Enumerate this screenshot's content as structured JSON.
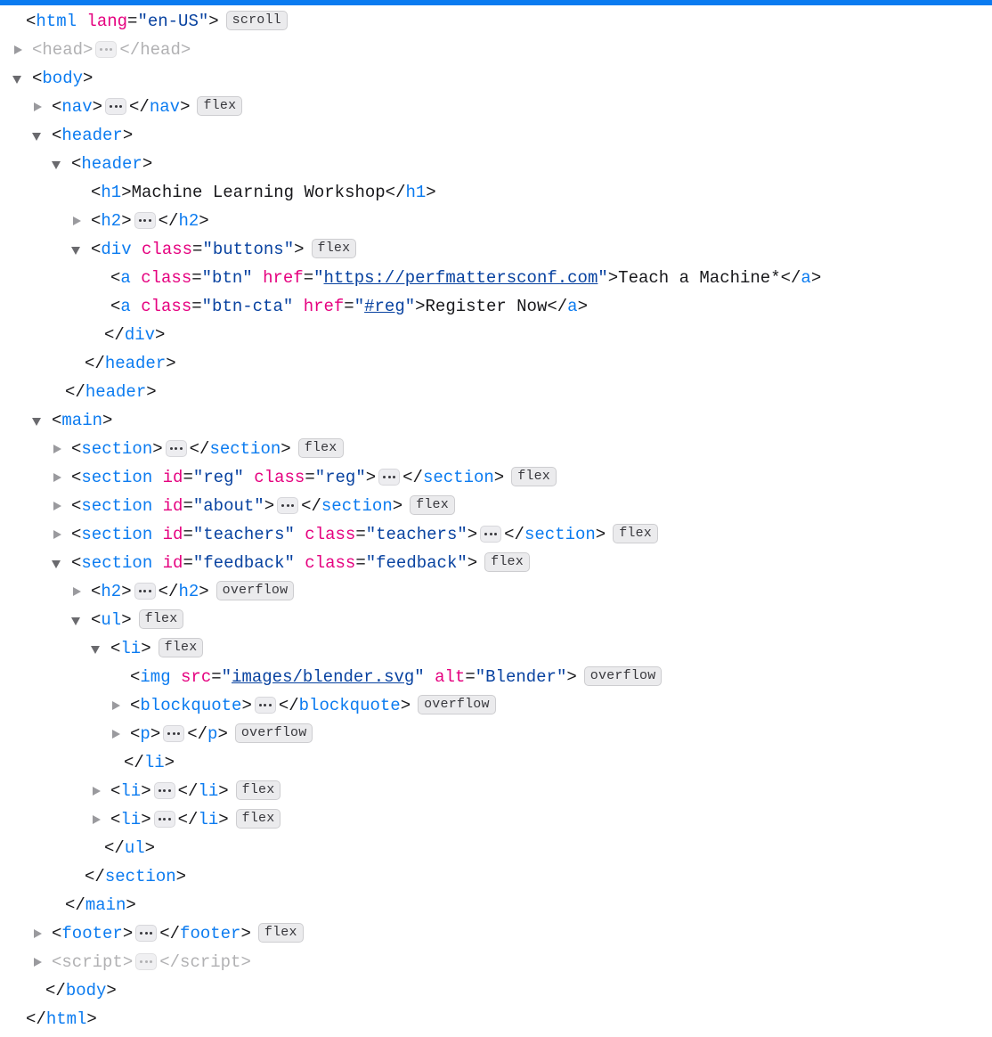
{
  "panel": {
    "name": "firefox-devtools-markup-view",
    "accent_color": "#0a7bf0",
    "tag_color": "#0b7bf0",
    "attribute_color": "#e5007f",
    "value_color": "#0842a0",
    "muted_color": "#b1b1b3",
    "badge_bg": "#ebebed"
  },
  "badges": {
    "scroll": "scroll",
    "flex": "flex",
    "overflow": "overflow"
  },
  "tokens": {
    "lt": "<",
    "gt": ">",
    "lt_slash": "</",
    "eq": "=",
    "quote": "\""
  },
  "nodes": [
    {
      "id": "html-open",
      "tag": "html",
      "attrs": [
        {
          "name": "lang",
          "value": "en-US"
        }
      ],
      "badge": "scroll"
    },
    {
      "id": "head",
      "tag": "head",
      "muted": true
    },
    {
      "id": "body-open",
      "tag": "body"
    },
    {
      "id": "nav",
      "tag": "nav",
      "badge": "flex"
    },
    {
      "id": "header-outer",
      "tag": "header"
    },
    {
      "id": "header-inner",
      "tag": "header"
    },
    {
      "id": "h1",
      "tag": "h1",
      "text": "Machine Learning Workshop"
    },
    {
      "id": "h2-hero",
      "tag": "h2"
    },
    {
      "id": "div-buttons",
      "tag": "div",
      "attrs": [
        {
          "name": "class",
          "value": "buttons"
        }
      ],
      "badge": "flex"
    },
    {
      "id": "a-btn",
      "tag": "a",
      "attrs": [
        {
          "name": "class",
          "value": "btn"
        },
        {
          "name": "href",
          "value": "https://perfmattersconf.com",
          "link": true
        }
      ],
      "text": "Teach a Machine*"
    },
    {
      "id": "a-btn-cta",
      "tag": "a",
      "attrs": [
        {
          "name": "class",
          "value": "btn-cta"
        },
        {
          "name": "href",
          "value": "#reg",
          "link": true
        }
      ],
      "text": "Register Now"
    },
    {
      "id": "div-buttons-close",
      "tag": "div"
    },
    {
      "id": "header-inner-close",
      "tag": "header"
    },
    {
      "id": "header-outer-close",
      "tag": "header"
    },
    {
      "id": "main-open",
      "tag": "main"
    },
    {
      "id": "section-hero",
      "tag": "section",
      "badge": "flex"
    },
    {
      "id": "section-reg",
      "tag": "section",
      "attrs": [
        {
          "name": "id",
          "value": "reg"
        },
        {
          "name": "class",
          "value": "reg"
        }
      ],
      "badge": "flex"
    },
    {
      "id": "section-about",
      "tag": "section",
      "attrs": [
        {
          "name": "id",
          "value": "about"
        }
      ],
      "badge": "flex"
    },
    {
      "id": "section-teachers",
      "tag": "section",
      "attrs": [
        {
          "name": "id",
          "value": "teachers"
        },
        {
          "name": "class",
          "value": "teachers"
        }
      ],
      "badge": "flex"
    },
    {
      "id": "section-feedback",
      "tag": "section",
      "attrs": [
        {
          "name": "id",
          "value": "feedback"
        },
        {
          "name": "class",
          "value": "feedback"
        }
      ],
      "badge": "flex"
    },
    {
      "id": "h2-feedback",
      "tag": "h2",
      "badge": "overflow"
    },
    {
      "id": "ul",
      "tag": "ul",
      "badge": "flex"
    },
    {
      "id": "li-1",
      "tag": "li",
      "badge": "flex"
    },
    {
      "id": "img-blender",
      "tag": "img",
      "attrs": [
        {
          "name": "src",
          "value": "images/blender.svg",
          "link": true
        },
        {
          "name": "alt",
          "value": "Blender"
        }
      ],
      "badge": "overflow"
    },
    {
      "id": "blockquote",
      "tag": "blockquote",
      "badge": "overflow"
    },
    {
      "id": "p",
      "tag": "p",
      "badge": "overflow"
    },
    {
      "id": "li-1-close",
      "tag": "li"
    },
    {
      "id": "li-2",
      "tag": "li",
      "badge": "flex"
    },
    {
      "id": "li-3",
      "tag": "li",
      "badge": "flex"
    },
    {
      "id": "ul-close",
      "tag": "ul"
    },
    {
      "id": "section-feedback-close",
      "tag": "section"
    },
    {
      "id": "main-close",
      "tag": "main"
    },
    {
      "id": "footer",
      "tag": "footer",
      "badge": "flex"
    },
    {
      "id": "script",
      "tag": "script",
      "muted": true
    },
    {
      "id": "body-close",
      "tag": "body"
    },
    {
      "id": "html-close",
      "tag": "html"
    }
  ]
}
